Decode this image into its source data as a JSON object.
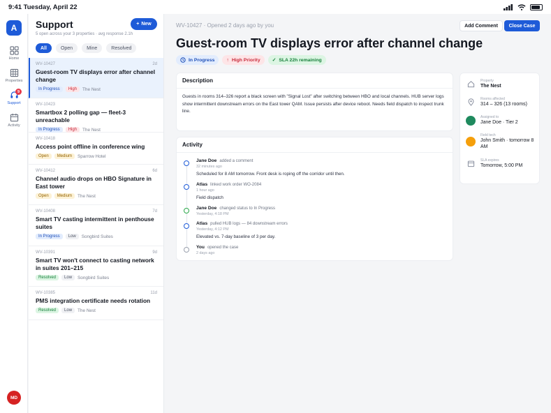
{
  "status_bar": {
    "time_date": "9:41  Tuesday, April 22",
    "battery_level_percent": 85
  },
  "rail": {
    "logo": "A",
    "items": [
      {
        "label": "Home",
        "icon": "grid-icon"
      },
      {
        "label": "Properties",
        "icon": "building-icon"
      },
      {
        "label": "Support",
        "icon": "headset-icon",
        "badge": "9"
      },
      {
        "label": "Activity",
        "icon": "calendar-icon"
      }
    ],
    "avatar": "MD"
  },
  "list": {
    "title": "Support",
    "new_button": "New",
    "subtitle": "5 open across your 3 properties · avg response 2.1h",
    "filters": [
      "All",
      "Open",
      "Mine",
      "Resolved"
    ],
    "tickets": [
      {
        "id": "WV-10427",
        "age": "2d",
        "title": "Guest-room TV displays error after channel change",
        "status": "In Progress",
        "priority": "High",
        "property": "The Nest"
      },
      {
        "id": "WV-10423",
        "age": "",
        "title": "Smartbox 2 polling gap — fleet-3 unreachable",
        "status": "In Progress",
        "priority": "High",
        "property": "The Nest"
      },
      {
        "id": "WV-10418",
        "age": "",
        "title": "Access point offline in conference wing",
        "status": "Open",
        "priority": "Medium",
        "property": "Sparrow Hotel"
      },
      {
        "id": "WV-10412",
        "age": "6d",
        "title": "Channel audio drops on HBO Signature in East tower",
        "status": "Open",
        "priority": "Medium",
        "property": "The Nest"
      },
      {
        "id": "WV-10408",
        "age": "7d",
        "title": "Smart TV casting intermittent in penthouse suites",
        "status": "In Progress",
        "priority": "Low",
        "property": "Songbird Suites"
      },
      {
        "id": "WV-10391",
        "age": "9d",
        "title": "Smart TV won't connect to casting network in suites 201–215",
        "status": "Resolved",
        "priority": "Low",
        "property": "Songbird Suites"
      },
      {
        "id": "WV-10385",
        "age": "11d",
        "title": "PMS integration certificate needs rotation",
        "status": "Resolved",
        "priority": "Low",
        "property": "The Nest"
      }
    ]
  },
  "detail": {
    "meta": "WV-10427 · Opened 2 days ago by you",
    "add_comment": "Add Comment",
    "close_case": "Close Case",
    "title": "Guest-room TV displays error after channel change",
    "tags": {
      "status": "In Progress",
      "priority": "High Priority",
      "sla": "SLA 22h remaining"
    },
    "description_heading": "Description",
    "description": "Guests in rooms 314–326 report a black screen with \"Signal Lost\" after switching between HBO and local channels. HUB server logs show intermittent downstream errors on the East tower QAM. Issue persists after device reboot. Needs field dispatch to inspect trunk line.",
    "activity_heading": "Activity",
    "activity": [
      {
        "name": "Jane Doe",
        "action": "added a comment",
        "time": "32 minutes ago",
        "text": "Scheduled for 8 AM tomorrow. Front desk is roping off the corridor until then."
      },
      {
        "name": "Atlas",
        "action": "linked work order WO-2084",
        "time": "1 hour ago",
        "text": "Field dispatch"
      },
      {
        "name": "Jane Doe",
        "action": "changed status to In Progress",
        "time": "Yesterday, 4:18 PM",
        "text": ""
      },
      {
        "name": "Atlas",
        "action": "pulled HUB logs — 84 downstream errors",
        "time": "Yesterday, 4:12 PM",
        "text": "Elevated vs. 7-day baseline of 3 per day."
      },
      {
        "name": "You",
        "action": "opened the case",
        "time": "2 days ago",
        "text": ""
      }
    ],
    "sidebar": [
      {
        "label": "Property",
        "value": "The Nest",
        "icon": "home-icon"
      },
      {
        "label": "Rooms affected",
        "value": "314 – 326 (13 rooms)",
        "icon": "pin-icon"
      },
      {
        "label": "Assigned to",
        "value": "Jane Doe · Tier 2",
        "color": "#1f8a5e"
      },
      {
        "label": "Field tech",
        "value": "John Smith · tomorrow 8 AM",
        "color": "#f59f0b"
      },
      {
        "label": "SLA expires",
        "value": "Tomorrow, 5:00 PM",
        "icon": "calendar-icon"
      }
    ]
  }
}
